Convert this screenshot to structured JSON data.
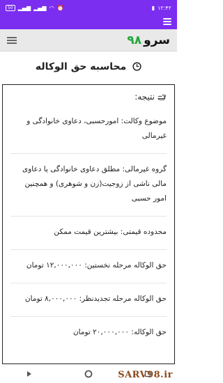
{
  "status": {
    "time": "۱۲:۴۲",
    "battery": "50"
  },
  "app": {
    "logo_text": "سرو",
    "logo_number": "۹۸"
  },
  "page": {
    "title": "محاسبه حق الوکاله"
  },
  "result": {
    "header": "نتیجه:",
    "items": [
      "موضوع وکالت: امورحسبی، دعاوی خانوادگی و غیرمالی",
      "گروه غیرمالی: مطلق دعاوی خانوادگی یا دعاوی مالی ناشی از زوجیت(زن و شوهری) و همچنین امور حسبی",
      "محدوده قیمتی: بیشترین قیمت ممکن",
      "حق الوکاله مرحله نخستین: ۱۲,۰۰۰,۰۰۰ تومان",
      "حق الوکاله مرحله تجدیدنظر: ۸,۰۰۰,۰۰۰ تومان",
      "حق الوکاله: ۲۰,۰۰۰,۰۰۰ تومان"
    ]
  },
  "watermark": "SARV98.ir",
  "colors": {
    "status_bar": "#7b2df0",
    "logo_number": "#24a83a"
  },
  "icons": [
    "menu-icon",
    "hamburger-icon",
    "clock-icon",
    "hand-pointer-icon",
    "back-icon",
    "home-icon",
    "recents-icon"
  ]
}
